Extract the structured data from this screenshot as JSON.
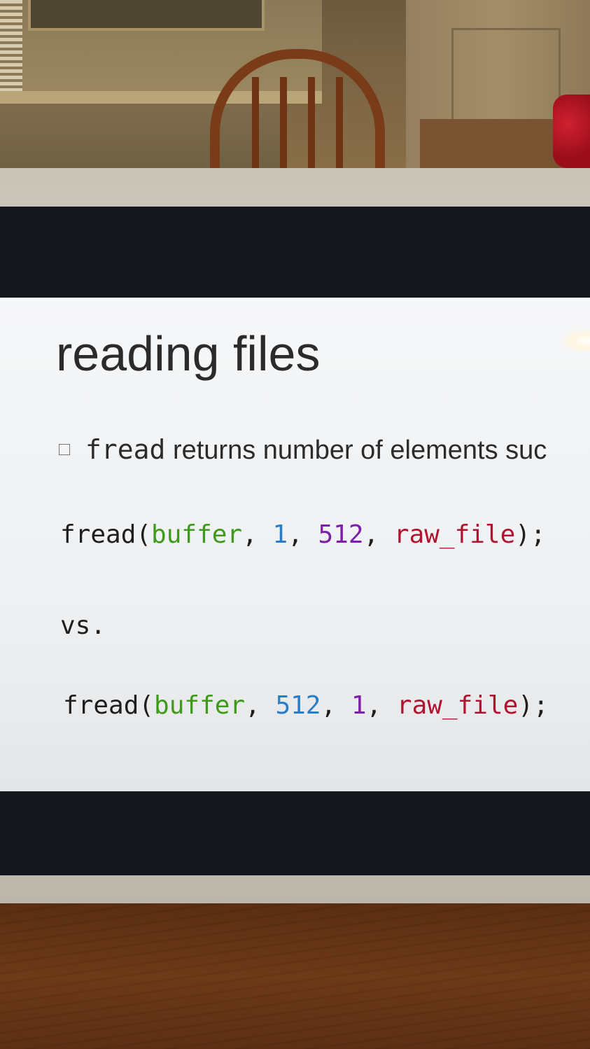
{
  "slide": {
    "title": "reading files",
    "bullet": {
      "code_word": "fread",
      "text": " returns number of elements suc"
    },
    "code_line_1": {
      "func": "fread(",
      "arg1": "buffer",
      "sep1": ", ",
      "arg2": "1",
      "sep2": ", ",
      "arg3": "512",
      "sep3": ", ",
      "arg4": "raw_file",
      "end": ");"
    },
    "separator": "vs.",
    "code_line_2": {
      "func": "fread(",
      "arg1": "buffer",
      "sep1": ", ",
      "arg2": "512",
      "sep2": ", ",
      "arg3": "1",
      "sep3": ", ",
      "arg4": "raw_file",
      "end": ");"
    }
  },
  "colors": {
    "arg_buffer": "#3e9a1c",
    "arg_blue": "#2a7ec9",
    "arg_purple": "#7d1fa8",
    "arg_file": "#b0142e"
  }
}
